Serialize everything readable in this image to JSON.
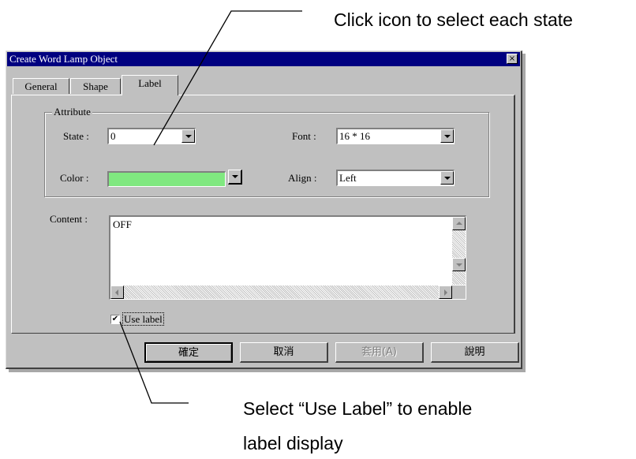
{
  "annotations": {
    "top": "Click icon to select each state",
    "bottom_line1": "Select “Use Label” to enable",
    "bottom_line2": "label display"
  },
  "dialog": {
    "title": "Create Word Lamp Object",
    "close_glyph": "×",
    "tabs": [
      "General",
      "Shape",
      "Label"
    ],
    "active_tab": "Label",
    "group_title": "Attribute",
    "state_label": "State :",
    "state_value": "0",
    "font_label": "Font :",
    "font_value": "16 * 16",
    "color_label": "Color :",
    "color_value": "#80e880",
    "align_label": "Align :",
    "align_value": "Left",
    "content_label": "Content :",
    "content_value": "OFF",
    "use_label_checked": true,
    "use_label_text": "Use label",
    "check_glyph": "✔",
    "buttons": {
      "ok": "確定",
      "cancel": "取消",
      "apply": "套用(A)",
      "help": "說明"
    }
  }
}
